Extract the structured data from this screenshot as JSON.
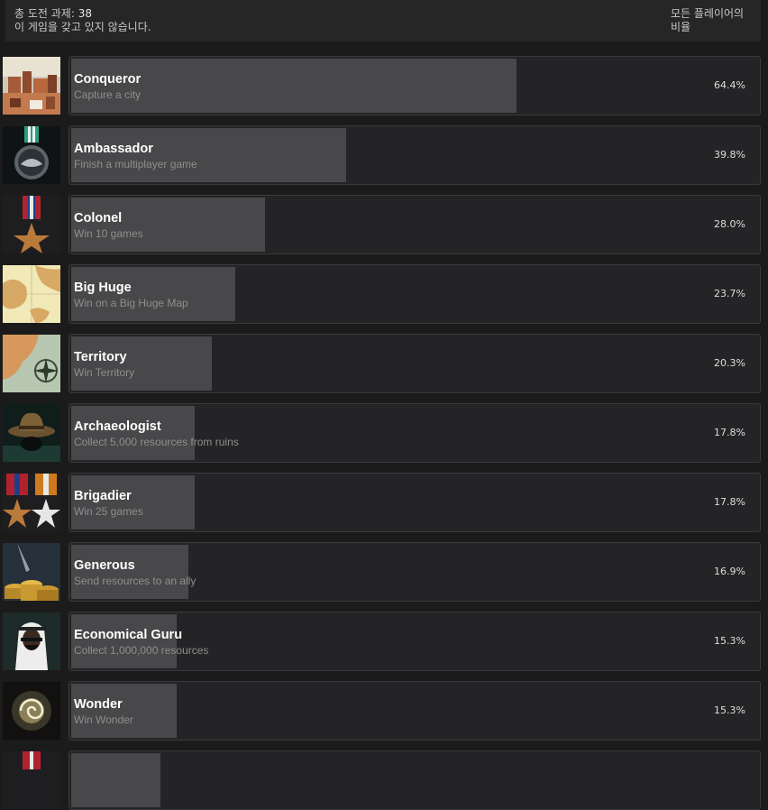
{
  "header": {
    "total_label": "총 도전 과제:",
    "total_count": "38",
    "not_owned": "이 게임을 갖고 있지 않습니다.",
    "column_title_line1": "모든 플레이어의",
    "column_title_line2": "비율"
  },
  "achievements": [
    {
      "name": "Conqueror",
      "description": "Capture a city",
      "percent": "64.4%",
      "icon": "city-icon"
    },
    {
      "name": "Ambassador",
      "description": "Finish a multiplayer game",
      "percent": "39.8%",
      "icon": "handshake-medal-icon"
    },
    {
      "name": "Colonel",
      "description": "Win 10 games",
      "percent": "28.0%",
      "icon": "bronze-star-medal-icon"
    },
    {
      "name": "Big Huge",
      "description": "Win on a Big Huge Map",
      "percent": "23.7%",
      "icon": "map-icon"
    },
    {
      "name": "Territory",
      "description": "Win Territory",
      "percent": "20.3%",
      "icon": "compass-map-icon"
    },
    {
      "name": "Archaeologist",
      "description": "Collect 5,000 resources from ruins",
      "percent": "17.8%",
      "icon": "fedora-hat-icon"
    },
    {
      "name": "Brigadier",
      "description": "Win 25 games",
      "percent": "17.8%",
      "icon": "two-star-medals-icon"
    },
    {
      "name": "Generous",
      "description": "Send resources to an ally",
      "percent": "16.9%",
      "icon": "gold-coins-icon"
    },
    {
      "name": "Economical Guru",
      "description": "Collect 1,000,000 resources",
      "percent": "15.3%",
      "icon": "sheikh-portrait-icon"
    },
    {
      "name": "Wonder",
      "description": "Win Wonder",
      "percent": "15.3%",
      "icon": "spiral-wonder-icon"
    },
    {
      "name": "",
      "description": "",
      "percent": "",
      "icon": "medal-icon"
    }
  ]
}
